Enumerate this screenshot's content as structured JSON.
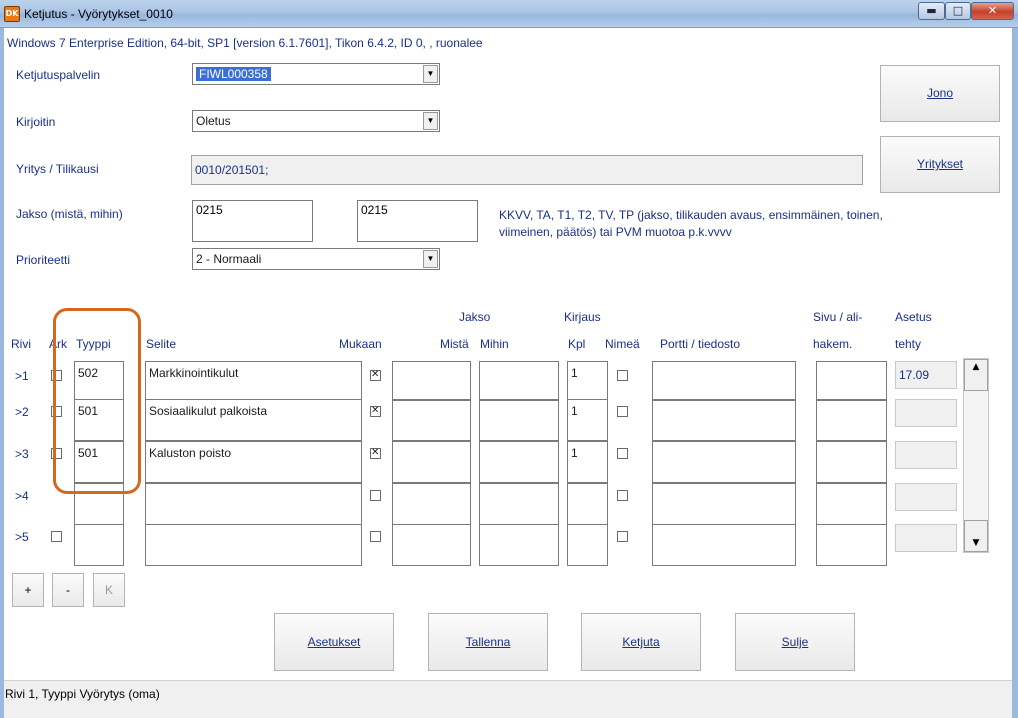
{
  "window": {
    "title": "Ketjutus - Vyörytykset_0010",
    "icon_text": "DK",
    "minimize": "▬",
    "maximize": "□",
    "close": "✕"
  },
  "sysinfo": "Windows 7 Enterprise Edition, 64-bit, SP1 [version 6.1.7601], Tikon 6.4.2, ID 0, , ruonalee",
  "form": {
    "server_label": "Ketjutuspalvelin",
    "server_value": "FIWL000358",
    "printer_label": "Kirjoitin",
    "printer_value": "Oletus",
    "company_label": "Yritys / Tilikausi",
    "company_value": "0010/201501;",
    "period_label": "Jakso (mistä, mihin)",
    "period_from": "0215",
    "period_to": "0215",
    "period_hint": "KKVV, TA, T1, T2, TV, TP (jakso, tilikauden avaus, ensimmäinen, toinen, viimeinen, päätös)  tai PVM muotoa p.k.vvvv",
    "priority_label": "Prioriteetti",
    "priority_value": "2 - Normaali"
  },
  "side_buttons": {
    "jono": "Jono",
    "yritykset": "Yritykset"
  },
  "grid": {
    "headers": {
      "rivi": "Rivi",
      "ark": "Ark",
      "tyyppi": "Tyyppi",
      "selite": "Selite",
      "mukaan": "Mukaan",
      "jakso": "Jakso",
      "mista": "Mistä",
      "mihin": "Mihin",
      "kirjaus": "Kirjaus",
      "kpl": "Kpl",
      "nimea": "Nimeä",
      "portti": "Portti / tiedosto",
      "sivu1": "Sivu / ali-",
      "sivu2": "hakem.",
      "asetus1": "Asetus",
      "asetus2": "tehty"
    },
    "rows": [
      {
        "rivi": ">1",
        "tyyppi": "502",
        "selite": "Markkinointikulut",
        "kpl": "1",
        "asetus": "17.09"
      },
      {
        "rivi": ">2",
        "tyyppi": "501",
        "selite": "Sosiaalikulut palkoista",
        "kpl": "1",
        "asetus": ""
      },
      {
        "rivi": ">3",
        "tyyppi": "501",
        "selite": "Kaluston poisto",
        "kpl": "1",
        "asetus": ""
      },
      {
        "rivi": ">4",
        "tyyppi": "",
        "selite": "",
        "kpl": "",
        "asetus": ""
      },
      {
        "rivi": ">5",
        "tyyppi": "",
        "selite": "",
        "kpl": "",
        "asetus": ""
      }
    ],
    "mukaan_checked": [
      true,
      true,
      true,
      false,
      false
    ],
    "add_button": "+",
    "remove_button": "-",
    "k_button": "K"
  },
  "buttons": {
    "asetukset": "Asetukset",
    "tallenna": "Tallenna",
    "ketjuta": "Ketjuta",
    "sulje": "Sulje"
  },
  "status": "Rivi 1, Tyyppi Vyörytys (oma)",
  "colors": {
    "label": "#1a2f8a",
    "highlight": "#d2691e",
    "selection": "#3b6fd8"
  }
}
